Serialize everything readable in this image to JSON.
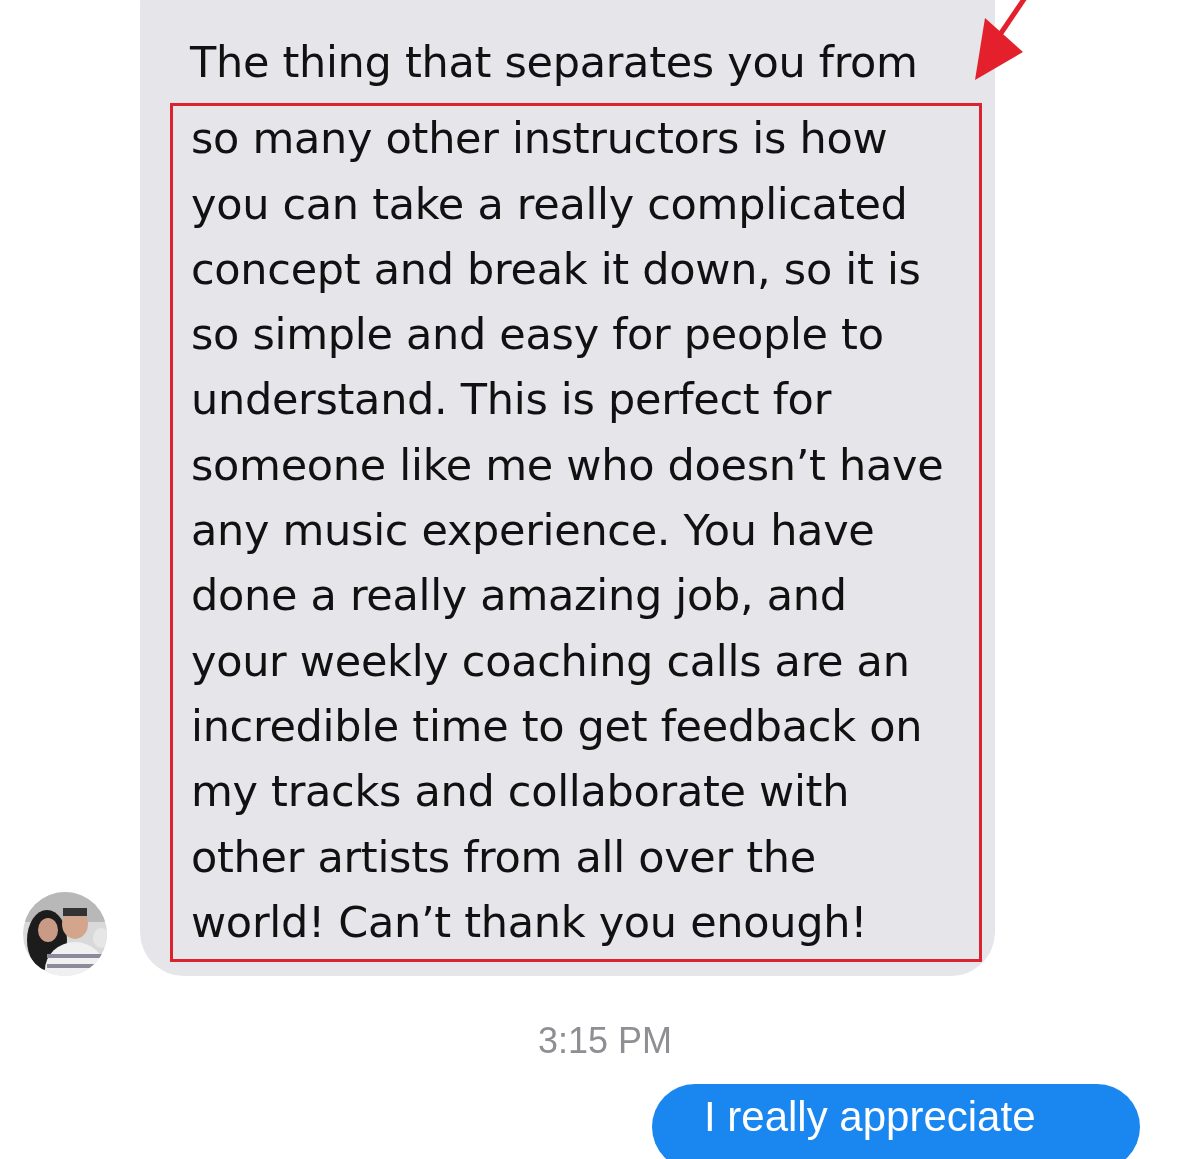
{
  "message": {
    "lines_before_highlight": [
      "The thing that separates you from"
    ],
    "highlighted_lines": [
      "so many other instructors is how",
      "you can take a really complicated",
      "concept and break it down, so it is",
      "so simple and easy for people to",
      "understand. This is perfect for",
      "someone like me who doesn’t have",
      "any music experience. You have",
      "done a really amazing job, and",
      "your weekly coaching calls are an",
      "incredible time to get feedback on",
      "my tracks and collaborate with",
      "other artists from all over the",
      "world! Can’t thank you enough!"
    ]
  },
  "timestamp": "3:15 PM",
  "reply": {
    "text": "I really appreciate"
  }
}
